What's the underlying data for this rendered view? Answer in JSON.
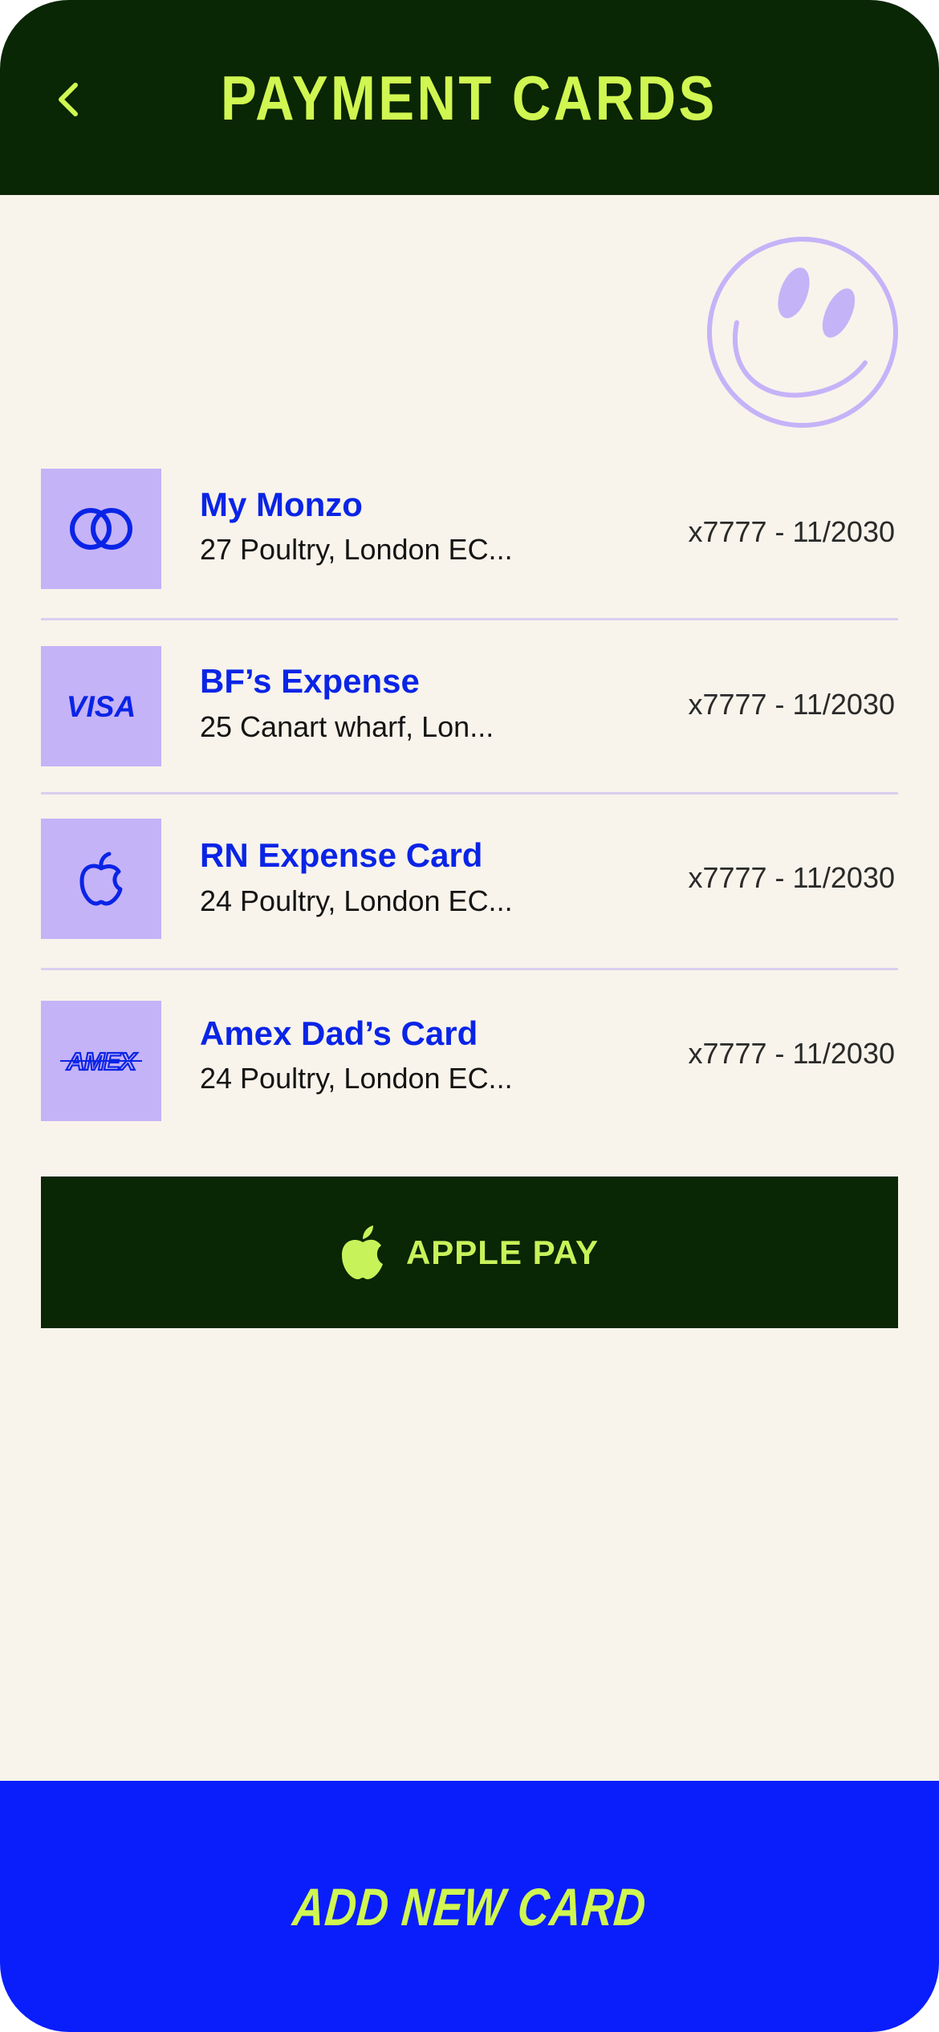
{
  "header": {
    "title": "PAYMENT CARDS",
    "back_icon": "chevron-left-icon"
  },
  "decoration": {
    "icon": "smiley-face-icon"
  },
  "cards": [
    {
      "name": "My Monzo",
      "address": "27 Poultry, London EC...",
      "meta": "x7777 - 11/2030",
      "icon": "mastercard-rings-icon"
    },
    {
      "name": "BF’s Expense",
      "address": "25 Canart wharf, Lon...",
      "meta": "x7777 - 11/2030",
      "icon": "visa-logo-icon",
      "logo_text": "VISA"
    },
    {
      "name": "RN Expense Card",
      "address": "24 Poultry, London EC...",
      "meta": "x7777 - 11/2030",
      "icon": "apple-logo-icon"
    },
    {
      "name": "Amex Dad’s Card",
      "address": "24 Poultry, London EC...",
      "meta": "x7777 - 11/2030",
      "icon": "amex-logo-icon",
      "logo_text": "AMEX"
    }
  ],
  "apple_pay": {
    "label": "APPLE PAY",
    "icon": "apple-logo-icon"
  },
  "footer": {
    "add_card_label": "ADD NEW CARD"
  },
  "colors": {
    "header_bg": "#092605",
    "accent_lime": "#d0f651",
    "brand_blue": "#0a24e6",
    "lavender": "#c5b3f8",
    "page_bg": "#f8f4eb",
    "footer_bg": "#0a1efb"
  }
}
